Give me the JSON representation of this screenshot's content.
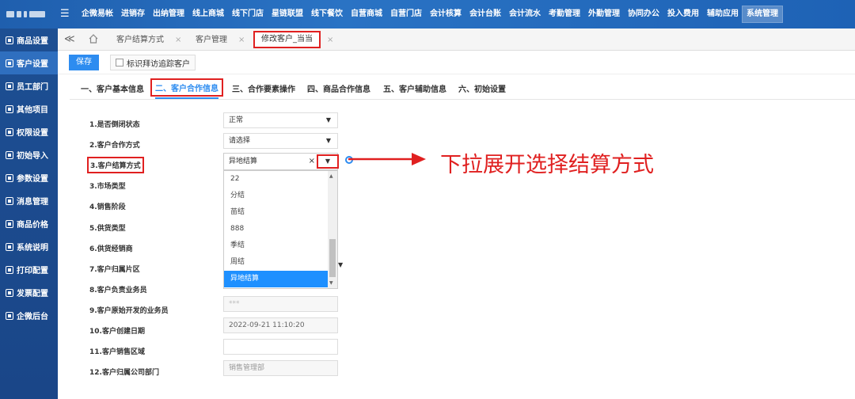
{
  "topnav": {
    "menu_icon": "menu-icon",
    "items": [
      "企微易帐",
      "进销存",
      "出纳管理",
      "线上商城",
      "线下门店",
      "星链联盟",
      "线下餐饮",
      "自营商城",
      "自营门店",
      "会计核算",
      "会计台账",
      "会计流水",
      "考勤管理",
      "外勤管理",
      "协同办公",
      "投入费用",
      "辅助应用",
      "系统管理"
    ],
    "active_index": 17
  },
  "sidebar": {
    "items": [
      "商品设置",
      "客户设置",
      "员工部门",
      "其他项目",
      "权限设置",
      "初始导入",
      "参数设置",
      "消息管理",
      "商品价格",
      "系统说明",
      "打印配置",
      "发票配置",
      "企微后台"
    ],
    "active_index": 1
  },
  "tabbar": {
    "tabs": [
      "客户结算方式",
      "客户管理",
      "修改客户_当当"
    ],
    "close": "×",
    "collapse": "≪"
  },
  "toolbar": {
    "save_label": "保存",
    "track_label": "标识拜访追踪客户"
  },
  "section_tabs": [
    "一、客户基本信息",
    "二、客户合作信息",
    "三、合作要素操作",
    "四、商品合作信息",
    "五、客户辅助信息",
    "六、初始设置"
  ],
  "form": {
    "labels": [
      "1.是否倒闭状态",
      "2.客户合作方式",
      "3.客户结算方式",
      "3.市场类型",
      "4.销售阶段",
      "5.供货类型",
      "6.供货经销商",
      "7.客户归属片区",
      "8.客户负责业务员",
      "9.客户原始开发的业务员",
      "10.客户创建日期",
      "11.客户销售区域",
      "12.客户归属公司部门"
    ],
    "closed_status": "正常",
    "coop_mode_placeholder": "请选择",
    "settlement_value": "异地结算",
    "original_dev_staff": "***",
    "create_date": "2022-09-21 11:10:20",
    "sales_area": "",
    "company_dept": "销售管理部"
  },
  "dropdown": {
    "options": [
      "22",
      "分结",
      "苗结",
      "888",
      "季结",
      "周结",
      "异地结算"
    ],
    "selected_index": 6,
    "clear": "×",
    "arrow": "▼"
  },
  "annotation": {
    "text": "下拉展开选择结算方式"
  },
  "colors": {
    "primary": "#2d8cf0",
    "highlight_red": "#e02020",
    "nav_blue": "#1f5fae",
    "selected_option": "#1e90ff"
  }
}
